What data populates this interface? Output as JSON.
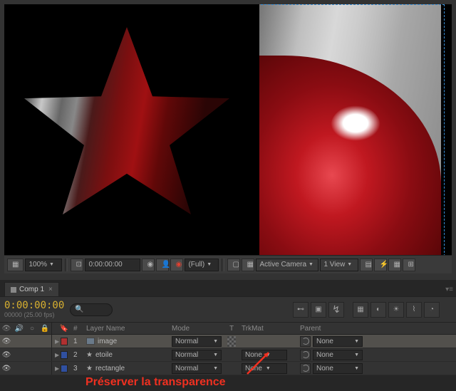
{
  "viewer_bar": {
    "zoom": "100%",
    "timecode": "0:00:00:00",
    "res": "(Full)",
    "camera": "Active Camera",
    "views": "1 View"
  },
  "tab": {
    "name": "Comp 1"
  },
  "timeline": {
    "timecode": "0:00:00:00",
    "sub": "00000 (25.00 fps)"
  },
  "headers": {
    "num": "#",
    "layer_name": "Layer Name",
    "mode": "Mode",
    "t": "T",
    "trkmat": "TrkMat",
    "parent": "Parent"
  },
  "layers": [
    {
      "num": "1",
      "name": "image",
      "mode": "Normal",
      "trkmat": "",
      "parent": "None",
      "type": "image",
      "color": "red"
    },
    {
      "num": "2",
      "name": "etoile",
      "mode": "Normal",
      "trkmat": "None",
      "parent": "None",
      "type": "star",
      "color": "blue"
    },
    {
      "num": "3",
      "name": "rectangle",
      "mode": "Normal",
      "trkmat": "None",
      "parent": "None",
      "type": "star",
      "color": "blue"
    }
  ],
  "annot": "Préserver la transparence"
}
